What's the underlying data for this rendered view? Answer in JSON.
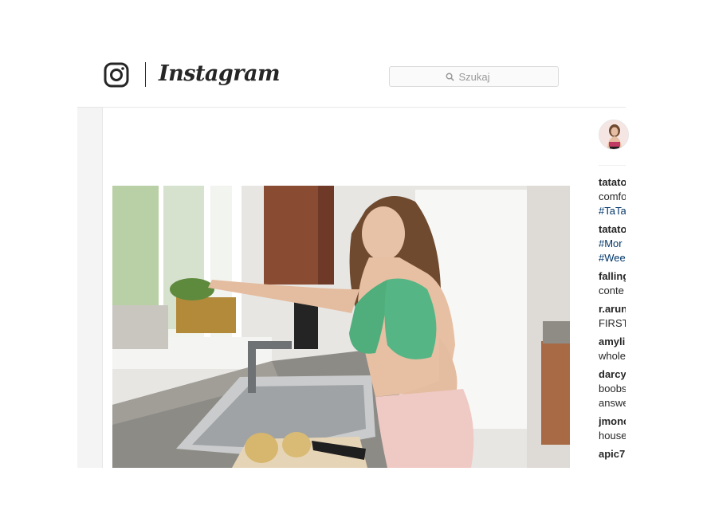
{
  "header": {
    "brand": "Instagram",
    "search_placeholder": "Szukaj"
  },
  "post": {
    "image_alt": "Woman in kitchen wearing green towel bra"
  },
  "comments": [
    {
      "user": "tatato",
      "lines": [
        {
          "text": "comfo",
          "tag": false
        },
        {
          "text": "#TaTa",
          "tag": true
        }
      ]
    },
    {
      "user": "tatato",
      "lines": [
        {
          "text": "#Mor",
          "tag": true
        },
        {
          "text": "#Wee",
          "tag": true
        }
      ]
    },
    {
      "user": "falling",
      "lines": [
        {
          "text": "conte",
          "tag": false
        }
      ]
    },
    {
      "user": "r.arun",
      "lines": [
        {
          "text": "FIRST",
          "tag": false
        }
      ]
    },
    {
      "user": "amyli",
      "lines": [
        {
          "text": "whole",
          "tag": false
        }
      ]
    },
    {
      "user": "darcy",
      "lines": [
        {
          "text": "boobs",
          "tag": false
        },
        {
          "text": "answe",
          "tag": false
        }
      ]
    },
    {
      "user": "jmonc",
      "lines": [
        {
          "text": "house",
          "tag": false
        }
      ]
    },
    {
      "user": "apic7",
      "lines": []
    }
  ]
}
